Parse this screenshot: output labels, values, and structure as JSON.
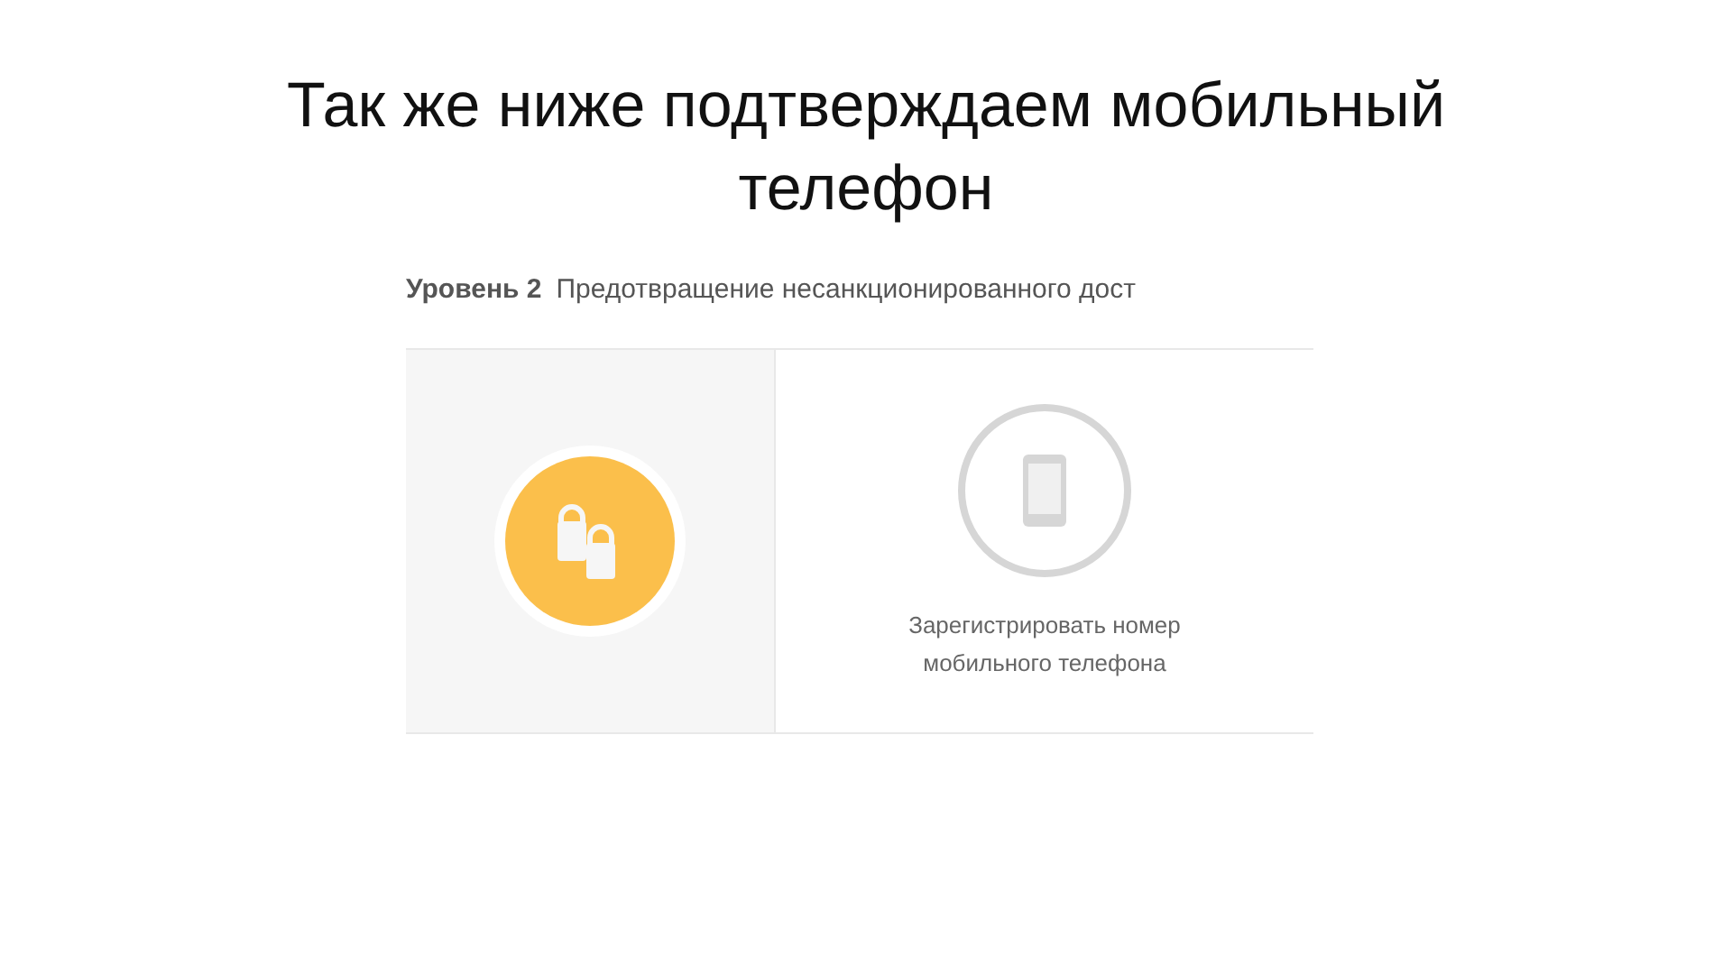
{
  "slide_title": "Так же ниже подтверждаем мобильный телефон",
  "section": {
    "level_label": "Уровень 2",
    "description": "Предотвращение несанкционированного дост"
  },
  "steps": [
    {
      "kind": "locks",
      "done": true
    },
    {
      "kind": "phone",
      "done": false,
      "label": "Зарегистрировать номер мобильного телефона"
    }
  ]
}
